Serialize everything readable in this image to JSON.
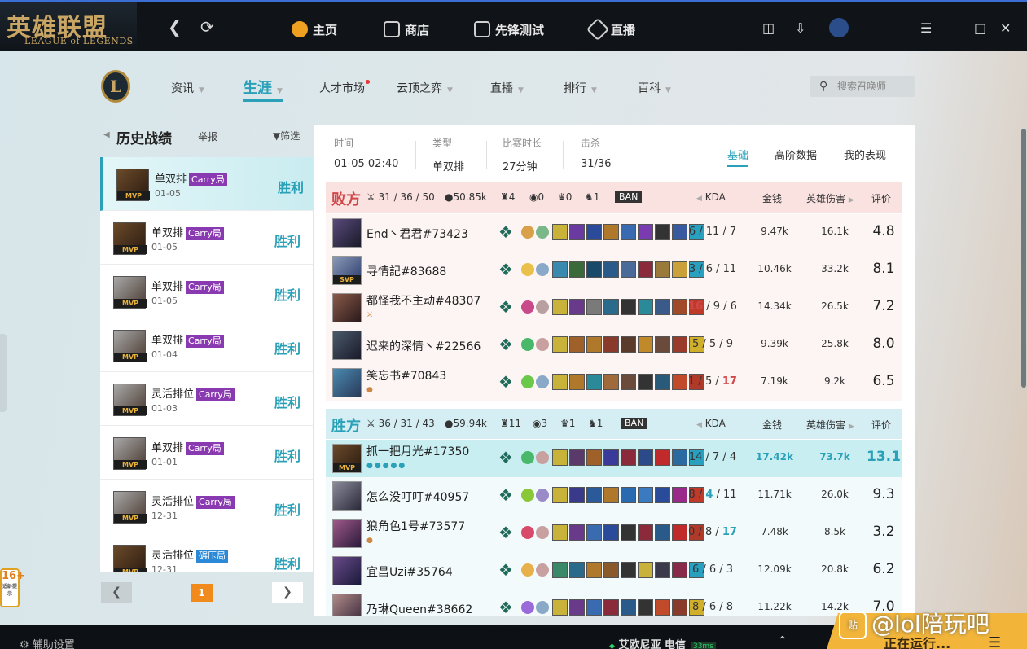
{
  "app": {
    "logo_cn": "英雄联盟",
    "logo_en": "LEAGUE of LEGENDS"
  },
  "topnav": {
    "items": [
      {
        "label": "主页",
        "icon": "home-icon"
      },
      {
        "label": "商店",
        "icon": "store-icon"
      },
      {
        "label": "先锋测试",
        "icon": "pbe-icon"
      },
      {
        "label": "直播",
        "icon": "live-icon"
      }
    ]
  },
  "gamenav": {
    "items": [
      "资讯",
      "生涯",
      "人才市场",
      "云顶之弈",
      "直播",
      "排行",
      "百科"
    ],
    "search_placeholder": "搜索召唤师"
  },
  "history": {
    "title": "历史战绩",
    "report": "举报",
    "filter": "筛选",
    "mvp": "MVP",
    "matches": [
      {
        "mode": "单双排",
        "tag": "Carry局",
        "date": "01-05",
        "result": "胜利"
      },
      {
        "mode": "单双排",
        "tag": "Carry局",
        "date": "01-05",
        "result": "胜利"
      },
      {
        "mode": "单双排",
        "tag": "Carry局",
        "date": "01-05",
        "result": "胜利"
      },
      {
        "mode": "单双排",
        "tag": "Carry局",
        "date": "01-04",
        "result": "胜利"
      },
      {
        "mode": "灵活排位",
        "tag": "Carry局",
        "date": "01-03",
        "result": "胜利"
      },
      {
        "mode": "单双排",
        "tag": "Carry局",
        "date": "01-01",
        "result": "胜利"
      },
      {
        "mode": "灵活排位",
        "tag": "Carry局",
        "date": "12-31",
        "result": "胜利"
      },
      {
        "mode": "灵活排位",
        "tag": "碾压局",
        "date": "12-31",
        "result": "胜利"
      }
    ],
    "page": "1"
  },
  "summary": {
    "time_label": "时间",
    "time": "01-05 02:40",
    "type_label": "类型",
    "type": "单双排",
    "duration_label": "比赛时长",
    "duration": "27分钟",
    "kills_label": "击杀",
    "kills": "31/36",
    "tabs": [
      "基础",
      "高阶数据",
      "我的表现"
    ]
  },
  "cols": {
    "kda": "KDA",
    "gold": "金钱",
    "damage": "英雄伤害",
    "score": "评价"
  },
  "ban_label": "BAN",
  "lose_team": {
    "name": "败方",
    "kda": "31 / 36 / 50",
    "gold": "50.85k",
    "towers": "4",
    "inhib": "0",
    "baron": "0",
    "dragon": "1",
    "players": [
      {
        "name": "End丶君君#73423",
        "sub": "",
        "kda": "6 / 11 / 7",
        "gold": "9.47k",
        "damage": "16.1k",
        "score": "4.8"
      },
      {
        "name": "寻情記#83688",
        "sub": "SVP",
        "kda": "3 / 6 / 11",
        "gold": "10.46k",
        "damage": "33.2k",
        "score": "8.1"
      },
      {
        "name": "都怪我不主动#48307",
        "sub": "",
        "kda": "16 / 9 / 6",
        "gold": "14.34k",
        "damage": "26.5k",
        "score": "7.2"
      },
      {
        "name": "迟来的深情丶#22566",
        "sub": "",
        "kda": "5 / 5 / 9",
        "gold": "9.39k",
        "damage": "25.8k",
        "score": "8.0"
      },
      {
        "name": "笑忘书#70843",
        "sub": "",
        "kda": "1 / 5 / 17",
        "gold": "7.19k",
        "damage": "9.2k",
        "score": "6.5"
      }
    ]
  },
  "win_team": {
    "name": "胜方",
    "kda": "36 / 31 / 43",
    "gold": "59.94k",
    "towers": "11",
    "inhib": "3",
    "baron": "1",
    "dragon": "1",
    "players": [
      {
        "name": "抓一把月光#17350",
        "sub": "MVP",
        "kda": "14 / 7 / 4",
        "gold": "17.42k",
        "damage": "73.7k",
        "score": "13.1"
      },
      {
        "name": "怎么没叮叮#40957",
        "sub": "",
        "kda": "8 / 4 / 11",
        "gold": "11.71k",
        "damage": "26.0k",
        "score": "9.3"
      },
      {
        "name": "狼角色1号#73577",
        "sub": "",
        "kda": "0 / 8 / 17",
        "gold": "7.48k",
        "damage": "8.5k",
        "score": "3.2"
      },
      {
        "name": "宜昌Uzi#35764",
        "sub": "",
        "kda": "6 / 6 / 3",
        "gold": "12.09k",
        "damage": "20.8k",
        "score": "6.2"
      },
      {
        "name": "乃琳Queen#38662",
        "sub": "",
        "kda": "8 / 6 / 8",
        "gold": "11.22k",
        "damage": "14.2k",
        "score": "7.0"
      }
    ]
  },
  "bottom": {
    "assist": "辅助设置",
    "server": "艾欧尼亚 电信",
    "ping": "33ms",
    "running": "正在运行...",
    "age": "16+",
    "age_note": "适龄提示"
  },
  "watermark": {
    "icon": "贴",
    "text": "@lol陪玩吧"
  },
  "colors": {
    "accent": "#2aa1b8",
    "lose": "#d04848",
    "mvp_gold": "#e8b23a",
    "carry_tag": "#8a3ab0",
    "crush_tag": "#2a8ad8"
  }
}
